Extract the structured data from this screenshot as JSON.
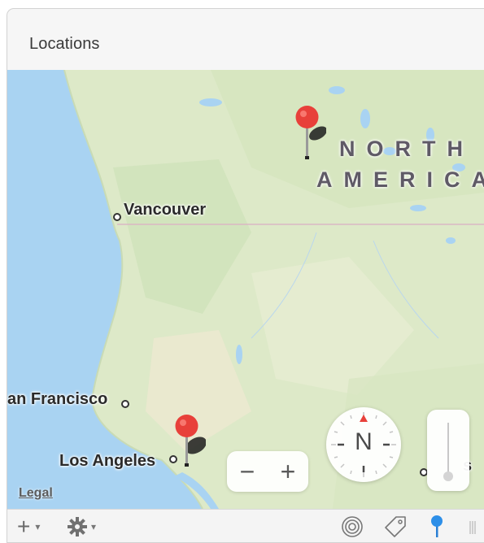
{
  "panel": {
    "title": "Locations"
  },
  "map": {
    "continent_label_line1": "NORTH",
    "continent_label_line2": "AMERICA",
    "cities": {
      "vancouver": "Vancouver",
      "san_francisco": "an Francisco",
      "los_angeles": "Los Angeles",
      "partial_city": "s"
    },
    "legal": "Legal",
    "compass_heading": "N",
    "colors": {
      "land": "#dde9c8",
      "water": "#a9d3f2",
      "pin": "#e8403a"
    }
  },
  "zoom": {
    "out_label": "−",
    "in_label": "+"
  },
  "toolbar": {
    "add_label": "+",
    "add_menu_arrow": "▾",
    "gear_menu_arrow": "▾",
    "icons": [
      "plus-icon",
      "gear-icon",
      "target-icon",
      "tag-icon",
      "pin-icon",
      "resize-handle-icon"
    ]
  }
}
